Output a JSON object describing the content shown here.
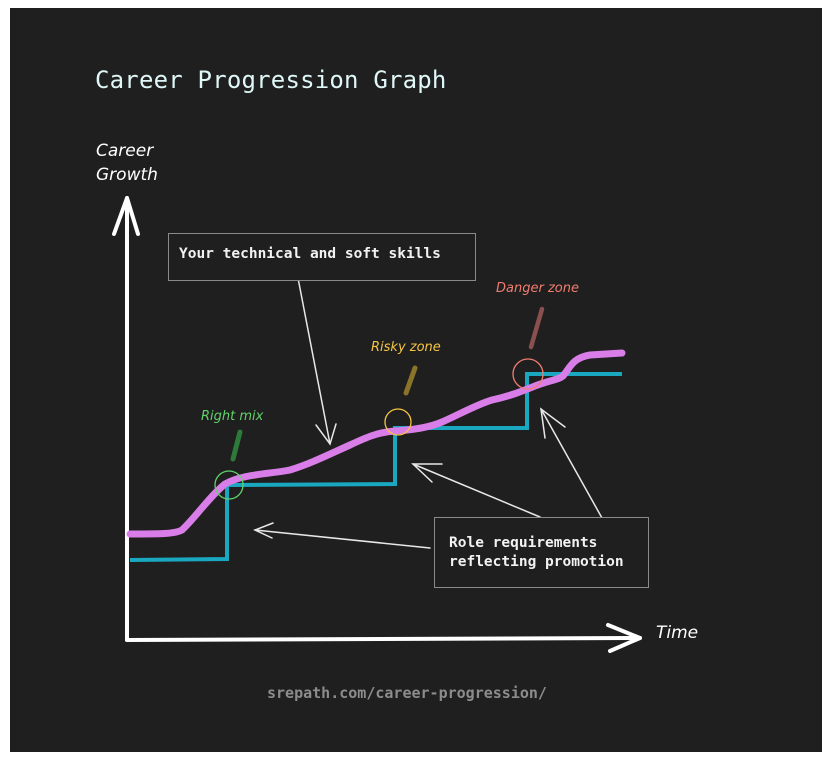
{
  "title": "Career Progression Graph",
  "axes": {
    "y_label_line1": "Career",
    "y_label_line2": "Growth",
    "x_label": "Time"
  },
  "callouts": {
    "skills": "Your technical and soft skills",
    "role_line1": "Role requirements",
    "role_line2": "reflecting promotion"
  },
  "zones": [
    {
      "label": "Right mix",
      "color": "#5fd46a",
      "marker_color": "#2e7a3a"
    },
    {
      "label": "Risky zone",
      "color": "#f5c542",
      "marker_color": "#8a7429"
    },
    {
      "label": "Danger zone",
      "color": "#f07c6f",
      "marker_color": "#8a4f4f"
    }
  ],
  "series": {
    "skills_curve": {
      "name": "Your technical and soft skills",
      "color": "#d97ee8"
    },
    "role_steps": {
      "name": "Role requirements reflecting promotion",
      "color": "#1aa7c0"
    }
  },
  "footer": "srepath.com/career-progression/"
}
